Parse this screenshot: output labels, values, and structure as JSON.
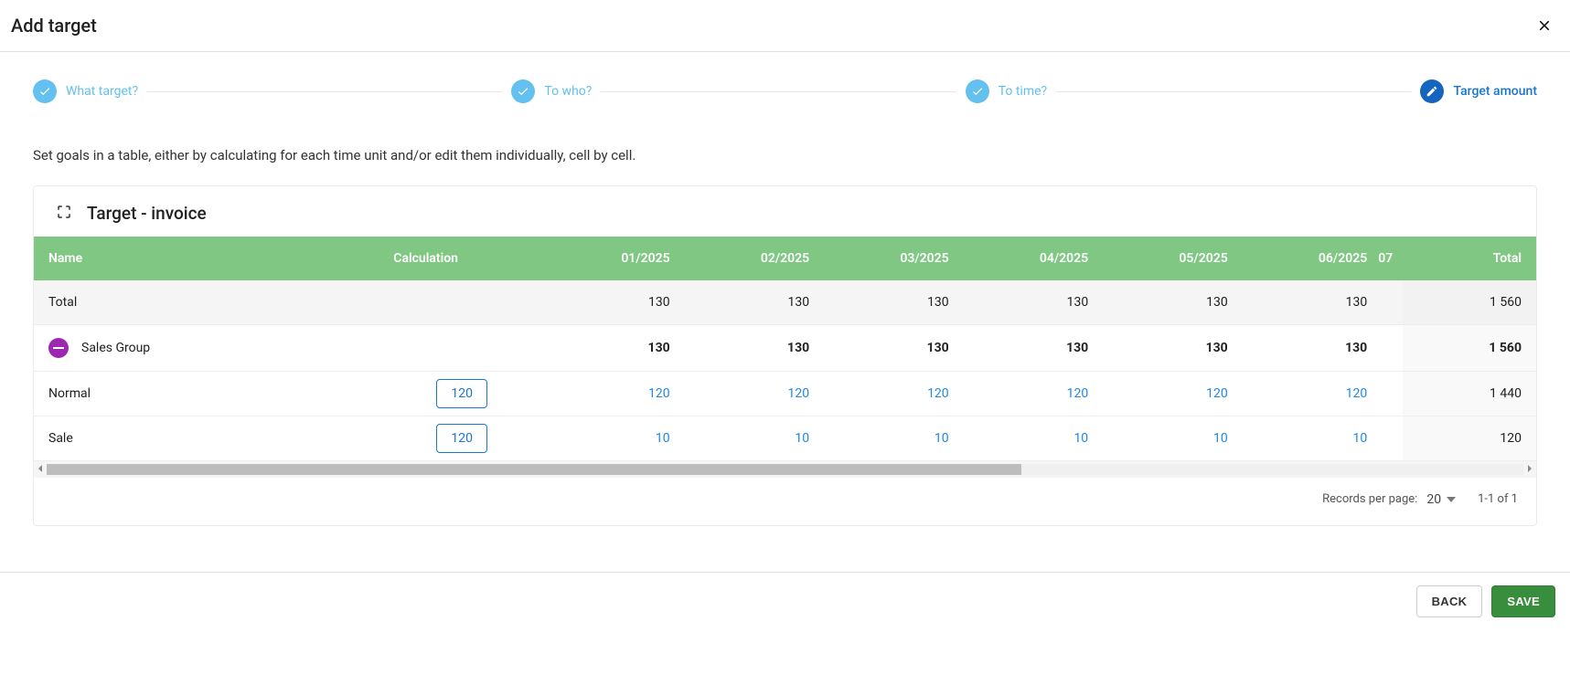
{
  "header": {
    "title": "Add target"
  },
  "stepper": {
    "steps": [
      {
        "label": "What target?",
        "state": "completed"
      },
      {
        "label": "To who?",
        "state": "completed"
      },
      {
        "label": "To time?",
        "state": "completed"
      },
      {
        "label": "Target amount",
        "state": "current"
      }
    ]
  },
  "description": "Set goals in a table, either by calculating for each time unit and/or edit them individually, cell by cell.",
  "card": {
    "title": "Target - invoice"
  },
  "table": {
    "columns": {
      "name": "Name",
      "calculation": "Calculation",
      "months": [
        "01/2025",
        "02/2025",
        "03/2025",
        "04/2025",
        "05/2025",
        "06/2025"
      ],
      "partial": "07",
      "total": "Total"
    },
    "rows": {
      "total": {
        "name": "Total",
        "months": [
          "130",
          "130",
          "130",
          "130",
          "130",
          "130"
        ],
        "total": "1 560"
      },
      "group": {
        "name": "Sales Group",
        "months": [
          "130",
          "130",
          "130",
          "130",
          "130",
          "130"
        ],
        "total": "1 560"
      },
      "normal": {
        "name": "Normal",
        "calc": "120",
        "months": [
          "120",
          "120",
          "120",
          "120",
          "120",
          "120"
        ],
        "total": "1 440"
      },
      "sale": {
        "name": "Sale",
        "calc": "120",
        "months": [
          "10",
          "10",
          "10",
          "10",
          "10",
          "10"
        ],
        "total": "120"
      }
    }
  },
  "pagination": {
    "label": "Records per page:",
    "size": "20",
    "range": "1-1 of 1"
  },
  "footer": {
    "back": "BACK",
    "save": "SAVE"
  }
}
